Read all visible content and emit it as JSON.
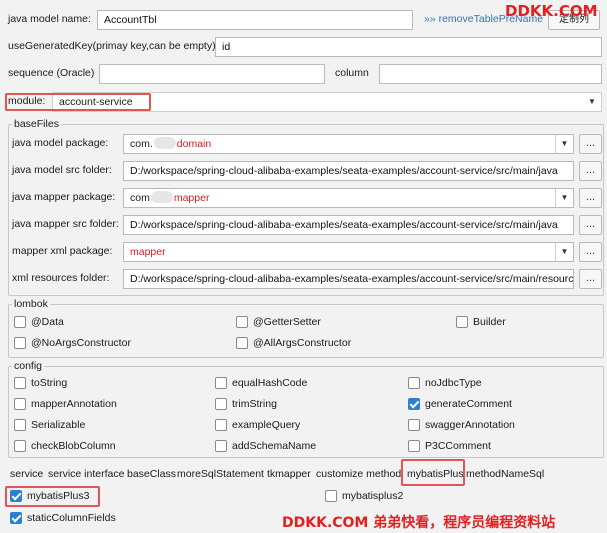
{
  "top": {
    "model_name_label": "java model name:",
    "model_name_value": "AccountTbl",
    "remove_prefix_link": "»» removeTablePreName",
    "dingzhi_button": "定制列",
    "use_generated_key_label": "useGeneratedKey(primay key,can be empty):",
    "use_generated_key_value": "id",
    "sequence_label": "sequence (Oracle)",
    "sequence_value": "",
    "column_label": "column",
    "column_value": "",
    "module_label": "module:",
    "module_value": "account-service"
  },
  "basefiles": {
    "title": "baseFiles",
    "rows": [
      {
        "label": "java model package:",
        "prefix": "com.",
        "value": "domain",
        "red": true,
        "combo": true
      },
      {
        "label": "java model src folder:",
        "prefix": "",
        "value": "D:/workspace/spring-cloud-alibaba-examples/seata-examples/account-service/src/main/java",
        "red": false,
        "combo": false
      },
      {
        "label": "java mapper package:",
        "prefix": "com",
        "value": "mapper",
        "red": true,
        "combo": true
      },
      {
        "label": "java mapper src folder:",
        "prefix": "",
        "value": "D:/workspace/spring-cloud-alibaba-examples/seata-examples/account-service/src/main/java",
        "red": false,
        "combo": false
      },
      {
        "label": "mapper xml package:",
        "prefix": "",
        "value": "mapper",
        "red": true,
        "combo": true
      },
      {
        "label": "xml resources folder:",
        "prefix": "",
        "value": "D:/workspace/spring-cloud-alibaba-examples/seata-examples/account-service/src/main/resources",
        "red": false,
        "combo": false
      }
    ],
    "browse_label": "..."
  },
  "lombok": {
    "title": "lombok",
    "items": [
      {
        "label": "@Data",
        "checked": false
      },
      {
        "label": "@GetterSetter",
        "checked": false
      },
      {
        "label": "Builder",
        "checked": false
      },
      {
        "label": "@NoArgsConstructor",
        "checked": false
      },
      {
        "label": "@AllArgsConstructor",
        "checked": false
      }
    ]
  },
  "config": {
    "title": "config",
    "items": [
      {
        "label": "toString",
        "checked": false
      },
      {
        "label": "equalHashCode",
        "checked": false
      },
      {
        "label": "noJdbcType",
        "checked": false
      },
      {
        "label": "mapperAnnotation",
        "checked": false
      },
      {
        "label": "trimString",
        "checked": false
      },
      {
        "label": "generateComment",
        "checked": true
      },
      {
        "label": "Serializable",
        "checked": false
      },
      {
        "label": "exampleQuery",
        "checked": false
      },
      {
        "label": "swaggerAnnotation",
        "checked": false
      },
      {
        "label": "checkBlobColumn",
        "checked": false
      },
      {
        "label": "addSchemaName",
        "checked": false
      },
      {
        "label": "P3CComment",
        "checked": false
      }
    ]
  },
  "tabs": [
    "service",
    "service interface",
    "baseClass",
    "moreSqlStatement",
    "tkmapper",
    "customize method",
    "mybatisPlus",
    "methodNameSql"
  ],
  "mybatis": {
    "mybatisPlus3": {
      "label": "mybatisPlus3",
      "checked": true
    },
    "mybatisplus2": {
      "label": "mybatisplus2",
      "checked": false
    },
    "staticColumnFields": {
      "label": "staticColumnFields",
      "checked": true
    }
  },
  "watermark": {
    "top": "DDKK.COM",
    "bottom": "DDKK.COM 弟弟快看，程序员编程资料站"
  },
  "colors": {
    "accent": "#2d7fd2",
    "highlight": "#e05555",
    "watermark": "#e32020"
  }
}
